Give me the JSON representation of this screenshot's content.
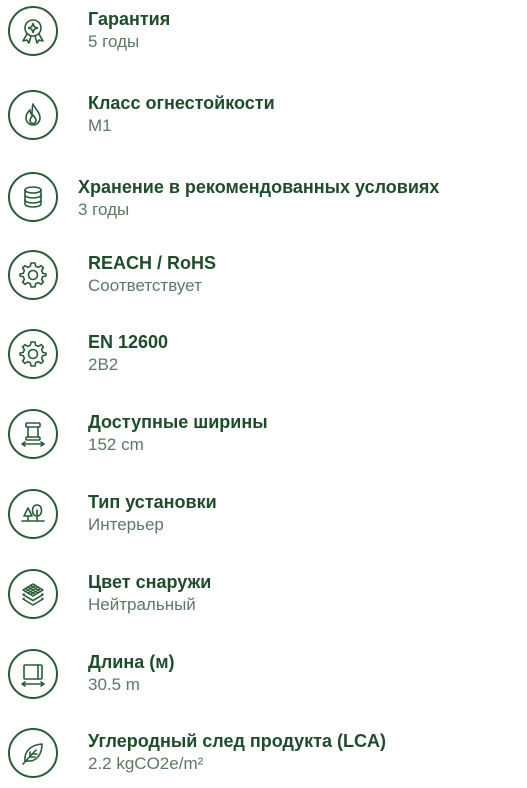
{
  "specs": [
    {
      "title": "Гарантия",
      "value": "5 годы",
      "icon": "warranty-badge-icon"
    },
    {
      "title": "Класс огнестойкости",
      "value": "M1",
      "icon": "flame-icon"
    },
    {
      "title": "Хранение в рекомендованных условиях",
      "value": "3 годы",
      "icon": "database-icon"
    },
    {
      "title": "REACH / RoHS",
      "value": "Соответствует",
      "icon": "gear-icon"
    },
    {
      "title": "EN 12600",
      "value": "2B2",
      "icon": "gear-icon"
    },
    {
      "title": "Доступные ширины",
      "value": "152 cm",
      "icon": "roll-width-icon"
    },
    {
      "title": "Тип установки",
      "value": "Интерьер",
      "icon": "tree-icon"
    },
    {
      "title": "Цвет снаружи",
      "value": "Нейтральный",
      "icon": "layers-icon"
    },
    {
      "title": "Длина (м)",
      "value": "30.5 m",
      "icon": "roll-length-icon"
    },
    {
      "title": "Углеродный след продукта (LCA)",
      "value": "2.2 kgCO2e/m²",
      "icon": "leaf-icon"
    }
  ]
}
